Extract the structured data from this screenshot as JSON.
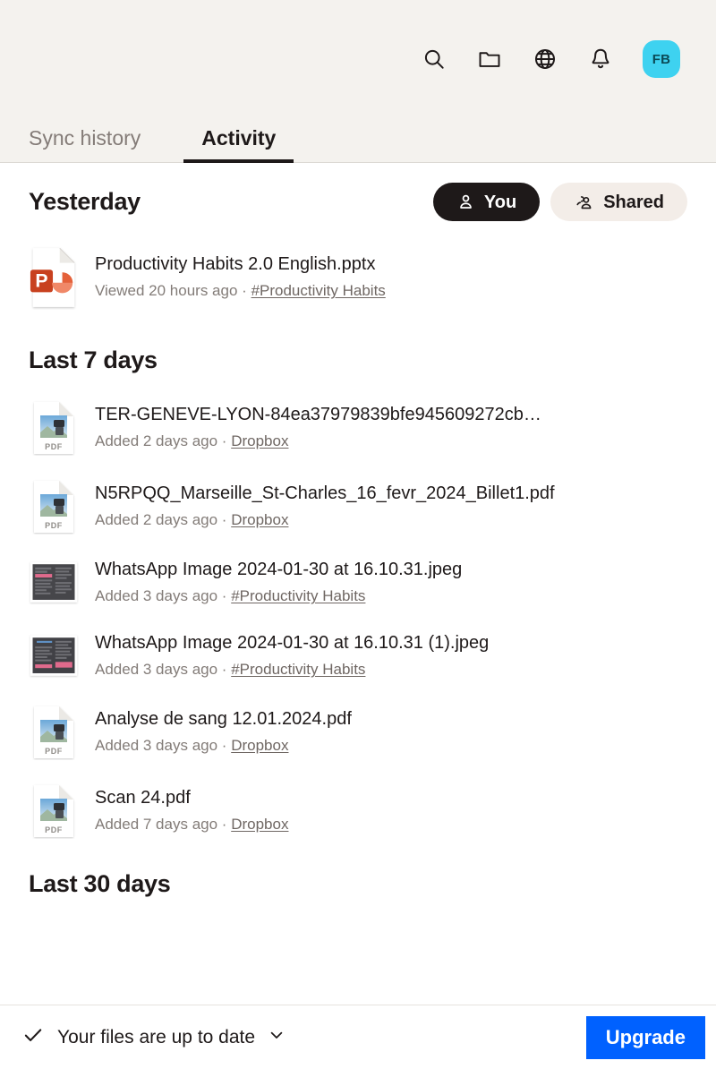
{
  "header": {
    "toolbar": [
      {
        "name": "search-icon",
        "label": "Search"
      },
      {
        "name": "folder-icon",
        "label": "Files"
      },
      {
        "name": "globe-icon",
        "label": "Web"
      },
      {
        "name": "bell-icon",
        "label": "Notifications"
      }
    ],
    "avatar": {
      "initials": "FB",
      "bg": "#3ed2f0",
      "fg": "#0b4a56"
    },
    "tabs": [
      {
        "label": "Sync history",
        "active": false
      },
      {
        "label": "Activity",
        "active": true
      }
    ]
  },
  "filters": {
    "you_label": "You",
    "shared_label": "Shared",
    "you_active": true,
    "shared_active": false
  },
  "sections": [
    {
      "title": "Yesterday",
      "items": [
        {
          "icon": "powerpoint",
          "name": "Productivity Habits 2.0 English.pptx",
          "action": "Viewed 20 hours ago",
          "separator": "·",
          "location": "#Productivity Habits"
        }
      ]
    },
    {
      "title": "Last 7 days",
      "items": [
        {
          "icon": "pdf",
          "name": "TER-GENEVE-LYON-84ea37979839bfe945609272cb…",
          "action": "Added 2 days ago",
          "separator": "·",
          "location": "Dropbox"
        },
        {
          "icon": "pdf",
          "name": "N5RPQQ_Marseille_St-Charles_16_fevr_2024_Billet1.pdf",
          "action": "Added 2 days ago",
          "separator": "·",
          "location": "Dropbox"
        },
        {
          "icon": "image-dark-doc",
          "name": "WhatsApp Image 2024-01-30 at 16.10.31.jpeg",
          "action": "Added 3 days ago",
          "separator": "·",
          "location": "#Productivity Habits"
        },
        {
          "icon": "image-dark-doc-2",
          "name": "WhatsApp Image 2024-01-30 at 16.10.31 (1).jpeg",
          "action": "Added 3 days ago",
          "separator": "·",
          "location": "#Productivity Habits"
        },
        {
          "icon": "pdf",
          "name": "Analyse de sang 12.01.2024.pdf",
          "action": "Added 3 days ago",
          "separator": "·",
          "location": "Dropbox"
        },
        {
          "icon": "pdf",
          "name": "Scan 24.pdf",
          "action": "Added 7 days ago",
          "separator": "·",
          "location": "Dropbox"
        }
      ]
    },
    {
      "title": "Last 30 days",
      "items": []
    }
  ],
  "statusbar": {
    "check_icon": "check-icon",
    "text": "Your files are up to date",
    "chevron_icon": "chevron-down-icon",
    "upgrade_label": "Upgrade",
    "upgrade_color": "#0061ff"
  }
}
